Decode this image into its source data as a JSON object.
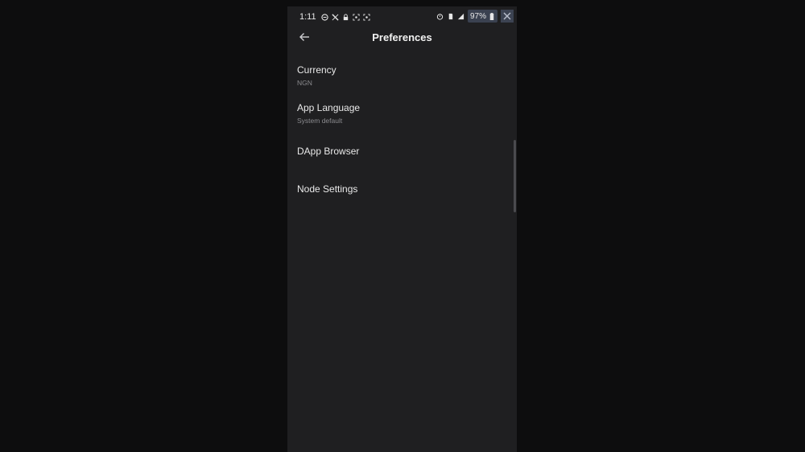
{
  "status_bar": {
    "time": "1:11",
    "battery_percent": "97%"
  },
  "header": {
    "title": "Preferences"
  },
  "preferences": [
    {
      "label": "Currency",
      "value": "NGN"
    },
    {
      "label": "App Language",
      "value": "System default"
    },
    {
      "label": "DApp Browser",
      "value": ""
    },
    {
      "label": "Node Settings",
      "value": ""
    }
  ],
  "colors": {
    "background": "#1f1f21",
    "text_primary": "#e9e9e9",
    "text_secondary": "#8b8b8f"
  },
  "icons": {
    "back": "arrow-left-icon",
    "dnd": "do-not-disturb-icon",
    "x_app": "x-logo-icon",
    "lock": "lock-icon",
    "screenshot": "screenshot-icon",
    "alarm": "alarm-icon",
    "sim": "sim-icon",
    "signal": "signal-icon",
    "battery": "battery-icon",
    "close": "close-icon"
  }
}
